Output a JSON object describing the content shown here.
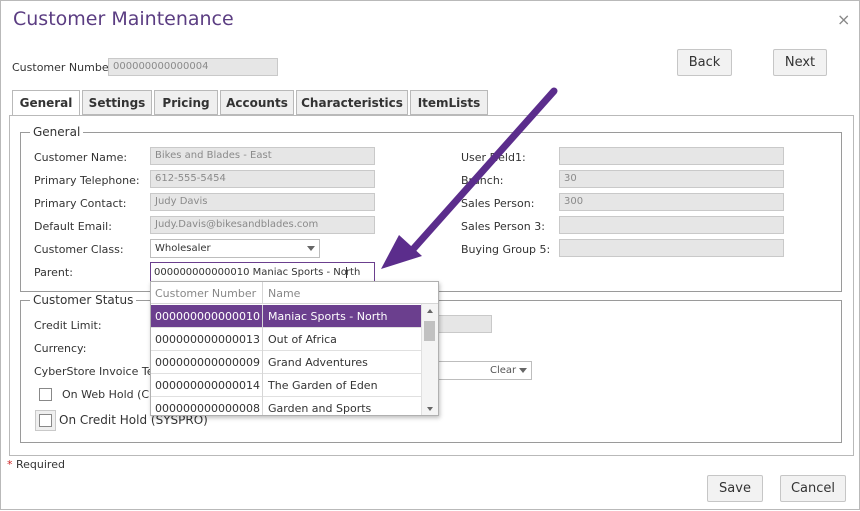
{
  "window": {
    "title": "Customer Maintenance",
    "close_glyph": "×"
  },
  "header": {
    "customer_number_label": "Customer Number:",
    "customer_number_value": "000000000000004"
  },
  "nav": {
    "back": "Back",
    "next": "Next"
  },
  "tabs": [
    {
      "label": "General",
      "active": true
    },
    {
      "label": "Settings"
    },
    {
      "label": "Pricing"
    },
    {
      "label": "Accounts"
    },
    {
      "label": "Characteristics"
    },
    {
      "label": "ItemLists"
    }
  ],
  "general": {
    "legend": "General",
    "customer_name_label": "Customer Name:",
    "customer_name": "Bikes and Blades - East",
    "primary_telephone_label": "Primary Telephone:",
    "primary_telephone": "612-555-5454",
    "primary_contact_label": "Primary Contact:",
    "primary_contact": "Judy Davis",
    "default_email_label": "Default Email:",
    "default_email": "Judy.Davis@bikesandblades.com",
    "customer_class_label": "Customer Class:",
    "customer_class": "Wholesaler",
    "parent_label": "Parent:",
    "parent_before_cursor": "000000000000010 Maniac Sports - No",
    "parent_after_cursor": "rth",
    "user_field1_label": "User Field1:",
    "user_field1": "",
    "branch_label": "Branch:",
    "branch": "30",
    "sales_person_label": "Sales Person:",
    "sales_person": "300",
    "sales_person3_label": "Sales Person 3:",
    "sales_person3": "",
    "buying_group5_label": "Buying Group 5:",
    "buying_group5": ""
  },
  "dropdown": {
    "col_number": "Customer Number",
    "col_name": "Name",
    "rows": [
      {
        "number": "000000000000010",
        "name": "Maniac Sports - North",
        "selected": true
      },
      {
        "number": "000000000000013",
        "name": "Out of Africa"
      },
      {
        "number": "000000000000009",
        "name": "Grand Adventures"
      },
      {
        "number": "000000000000014",
        "name": "The Garden of Eden"
      },
      {
        "number": "000000000000008",
        "name": "Garden and Sports"
      }
    ]
  },
  "status": {
    "legend": "Customer Status",
    "credit_limit_label": "Credit Limit:",
    "currency_label": "Currency:",
    "cyberstore_terms_label": "CyberStore Invoice Term",
    "clear_label": "Clear",
    "web_hold_label": "On Web Hold (Cus",
    "credit_hold_label": "On Credit Hold (SYSPRO)"
  },
  "footer": {
    "required_star": "*",
    "required_label": " Required",
    "save": "Save",
    "cancel": "Cancel"
  },
  "colors": {
    "accent": "#6b3f8e",
    "arrow": "#5b2d8c",
    "title": "#5b3d82",
    "required": "#cc2222"
  }
}
